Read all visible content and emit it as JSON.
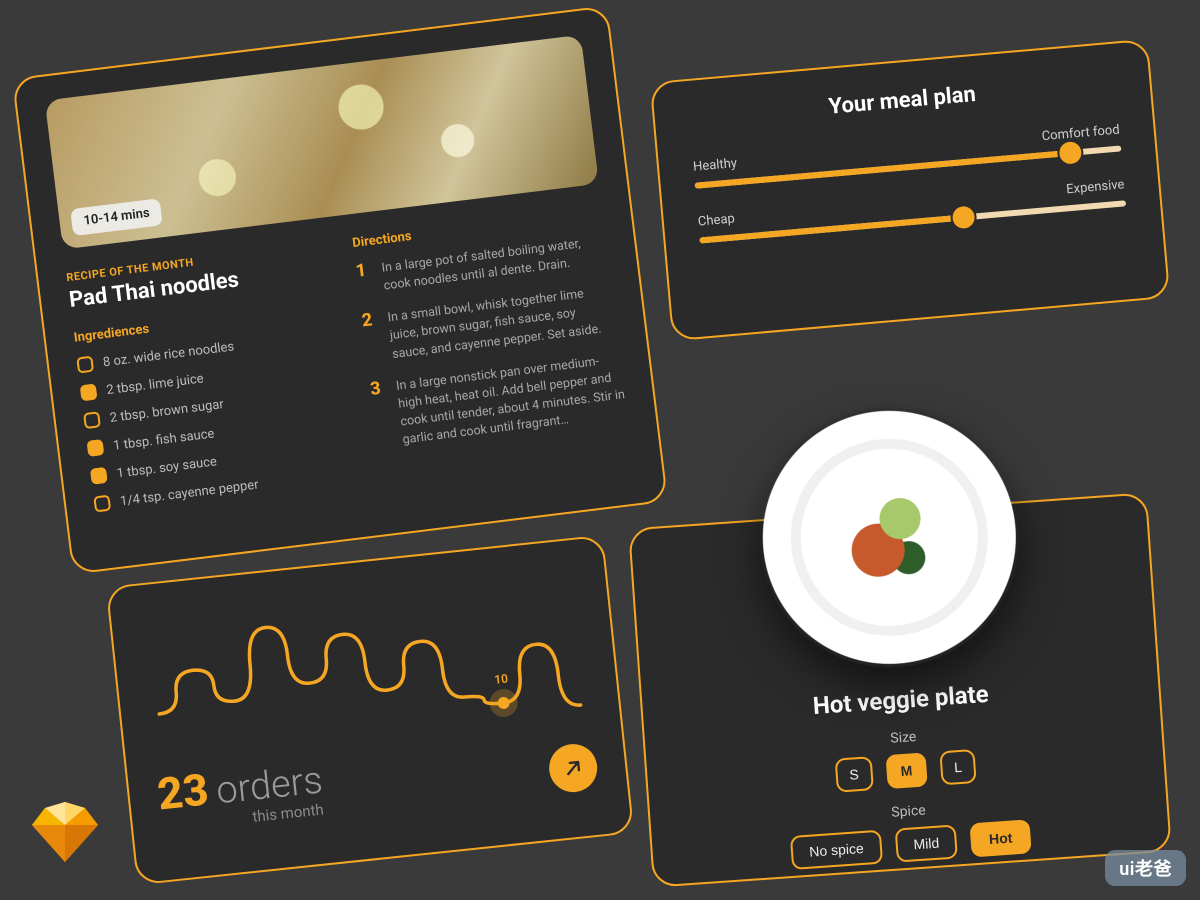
{
  "recipe": {
    "time_badge": "10-14 mins",
    "eyebrow": "RECIPE OF THE MONTH",
    "title": "Pad Thai noodles",
    "ingredients_heading": "Ingrediences",
    "ingredients": [
      {
        "text": "8 oz. wide rice noodles",
        "checked": false
      },
      {
        "text": "2 tbsp. lime juice",
        "checked": true
      },
      {
        "text": "2 tbsp. brown sugar",
        "checked": false
      },
      {
        "text": "1 tbsp. fish sauce",
        "checked": true
      },
      {
        "text": "1 tbsp. soy sauce",
        "checked": true
      },
      {
        "text": "1/4 tsp. cayenne pepper",
        "checked": false
      }
    ],
    "directions_heading": "Directions",
    "directions": [
      "In a large pot of salted boiling water, cook noodles until al dente. Drain.",
      "In a small bowl, whisk together lime juice, brown sugar, fish sauce, soy sauce, and cayenne pepper. Set aside.",
      "In a large nonstick pan over medium-high heat, heat oil. Add bell pepper and cook until tender, about 4 minutes. Stir in garlic and cook until fragrant…"
    ]
  },
  "mealplan": {
    "title": "Your meal plan",
    "sliders": [
      {
        "left": "Healthy",
        "right": "Comfort food",
        "value": 0.88
      },
      {
        "left": "Cheap",
        "right": "Expensive",
        "value": 0.62
      }
    ]
  },
  "orders": {
    "count": "23",
    "word": "orders",
    "sub": "this month",
    "point_label": "10"
  },
  "dish": {
    "title": "Hot veggie plate",
    "size_label": "Size",
    "sizes": [
      {
        "label": "S",
        "active": false
      },
      {
        "label": "M",
        "active": true
      },
      {
        "label": "L",
        "active": false
      }
    ],
    "spice_label": "Spice",
    "spice": [
      {
        "label": "No spice",
        "active": false
      },
      {
        "label": "Mild",
        "active": false
      },
      {
        "label": "Hot",
        "active": true
      }
    ]
  },
  "watermark": "ui老爸",
  "chart_data": {
    "type": "line",
    "title": "Orders this month",
    "x": [
      0,
      1,
      2,
      3,
      4,
      5,
      6,
      7,
      8,
      9,
      10,
      11
    ],
    "values": [
      55,
      95,
      60,
      130,
      70,
      115,
      55,
      100,
      40,
      30,
      85,
      20
    ],
    "highlight": {
      "index": 9,
      "label": "10"
    },
    "xlabel": "",
    "ylabel": "",
    "ylim": [
      0,
      160
    ]
  }
}
